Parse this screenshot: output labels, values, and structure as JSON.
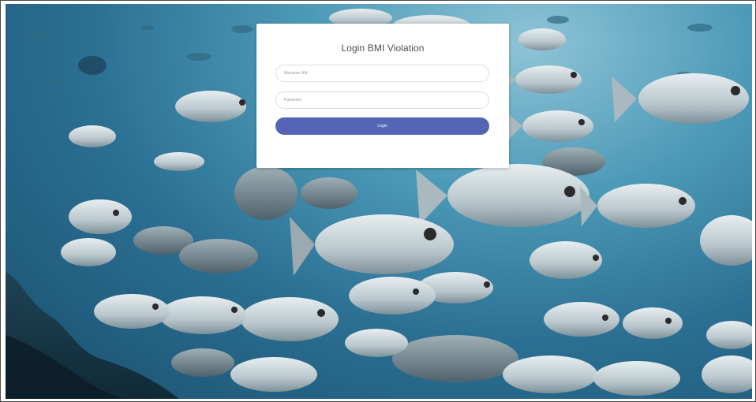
{
  "login": {
    "title": "Login BMI Violation",
    "username_placeholder": "Masukan NIK",
    "password_placeholder": "Password",
    "button_label": "Login"
  },
  "colors": {
    "button": "#5565b6",
    "card": "#ffffff",
    "background_water": "#2a6f92"
  }
}
